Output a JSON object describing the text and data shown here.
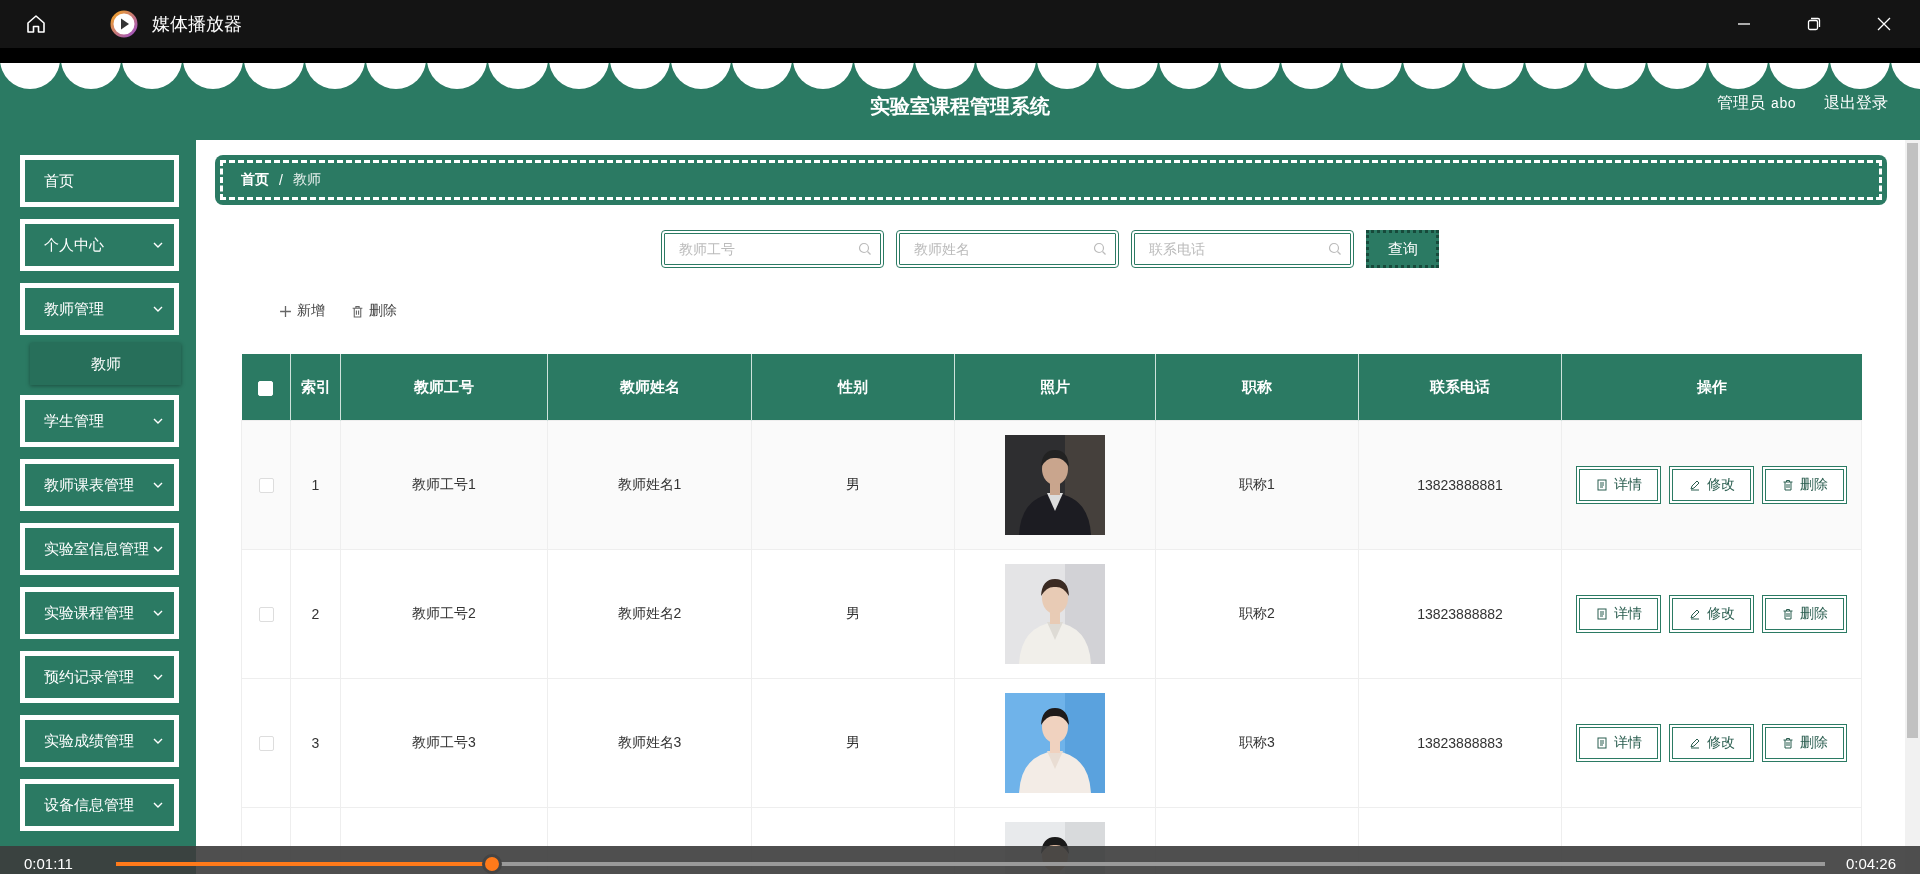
{
  "player": {
    "title": "媒体播放器",
    "elapsed": "0:01:11",
    "total": "0:04:26",
    "level": 0.22
  },
  "header": {
    "title": "实验室课程管理系统",
    "role": "管理员",
    "username": "abo",
    "logout": "退出登录"
  },
  "sidebar": {
    "items": [
      {
        "label": "首页",
        "kind": "link"
      },
      {
        "label": "个人中心",
        "kind": "menu"
      },
      {
        "label": "教师管理",
        "kind": "menu",
        "children": [
          {
            "label": "教师",
            "selected": true
          }
        ]
      },
      {
        "label": "学生管理",
        "kind": "menu"
      },
      {
        "label": "教师课表管理",
        "kind": "menu"
      },
      {
        "label": "实验室信息管理",
        "kind": "menu"
      },
      {
        "label": "实验课程管理",
        "kind": "menu"
      },
      {
        "label": "预约记录管理",
        "kind": "menu"
      },
      {
        "label": "实验成绩管理",
        "kind": "menu"
      },
      {
        "label": "设备信息管理",
        "kind": "menu"
      }
    ]
  },
  "breadcrumb": {
    "items": [
      "首页",
      "教师"
    ],
    "separator": "/"
  },
  "search": {
    "fields": [
      {
        "placeholder": "教师工号"
      },
      {
        "placeholder": "教师姓名"
      },
      {
        "placeholder": "联系电话"
      }
    ],
    "button": "查询"
  },
  "toolbar": [
    {
      "label": "新增",
      "kind": "add"
    },
    {
      "label": "删除",
      "kind": "delete"
    }
  ],
  "table": {
    "select_all_checked": false,
    "columns": [
      "索引",
      "教师工号",
      "教师姓名",
      "性别",
      "照片",
      "职称",
      "联系电话",
      "操作"
    ],
    "rows": [
      {
        "checked": false,
        "index": "1",
        "teacher_no": "教师工号1",
        "teacher_name": "教师姓名1",
        "gender": "男",
        "photo": {
          "kind": "picture"
        },
        "title": "职称1",
        "phone": "13823888881",
        "actions": [
          "详情",
          "修改",
          "删除"
        ]
      },
      {
        "checked": false,
        "index": "2",
        "teacher_no": "教师工号2",
        "teacher_name": "教师姓名2",
        "gender": "男",
        "photo": {
          "kind": "picture"
        },
        "title": "职称2",
        "phone": "13823888882",
        "actions": [
          "详情",
          "修改",
          "删除"
        ]
      },
      {
        "checked": false,
        "index": "3",
        "teacher_no": "教师工号3",
        "teacher_name": "教师姓名3",
        "gender": "男",
        "photo": {
          "kind": "picture"
        },
        "title": "职称3",
        "phone": "13823888883",
        "actions": [
          "详情",
          "修改",
          "删除"
        ]
      },
      {
        "photo": {
          "kind": "picture"
        }
      }
    ]
  }
}
